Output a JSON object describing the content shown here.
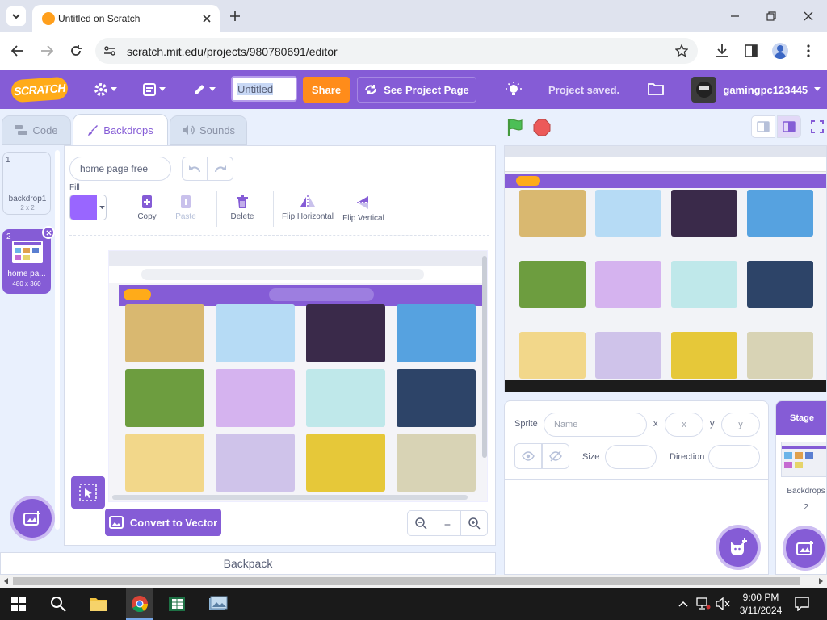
{
  "browser": {
    "tab_title": "Untitled on Scratch",
    "url": "scratch.mit.edu/projects/980780691/editor"
  },
  "menu": {
    "logo": "SCRATCH",
    "project_title": "Untitled",
    "share": "Share",
    "see_project": "See Project Page",
    "status": "Project saved.",
    "username": "gamingpc123445"
  },
  "tabs": {
    "code": "Code",
    "backdrops": "Backdrops",
    "sounds": "Sounds"
  },
  "backdrops": [
    {
      "index": "1",
      "name": "backdrop1",
      "size": "2 x 2"
    },
    {
      "index": "2",
      "name": "home pa...",
      "size": "480 x 360"
    }
  ],
  "paint": {
    "costume_name": "home page free",
    "fill_label": "Fill",
    "fill_color": "#9966ff",
    "copy": "Copy",
    "paste": "Paste",
    "delete": "Delete",
    "flip_h": "Flip Horizontal",
    "flip_v": "Flip Vertical",
    "convert": "Convert to Vector",
    "zoom_equal": "="
  },
  "sprite_info": {
    "sprite_label": "Sprite",
    "name_placeholder": "Name",
    "x_label": "x",
    "x_placeholder": "x",
    "y_label": "y",
    "y_placeholder": "y",
    "size_label": "Size",
    "direction_label": "Direction"
  },
  "stage_panel": {
    "title": "Stage",
    "backdrops_label": "Backdrops",
    "backdrops_count": "2"
  },
  "backpack": "Backpack",
  "taskbar": {
    "time": "9:00 PM",
    "date": "3/11/2024"
  },
  "colors": {
    "scratch_purple": "#855cd6",
    "share_orange": "#ff8c1a",
    "green_flag": "#4cbf56",
    "stop_red": "#ec5959"
  }
}
